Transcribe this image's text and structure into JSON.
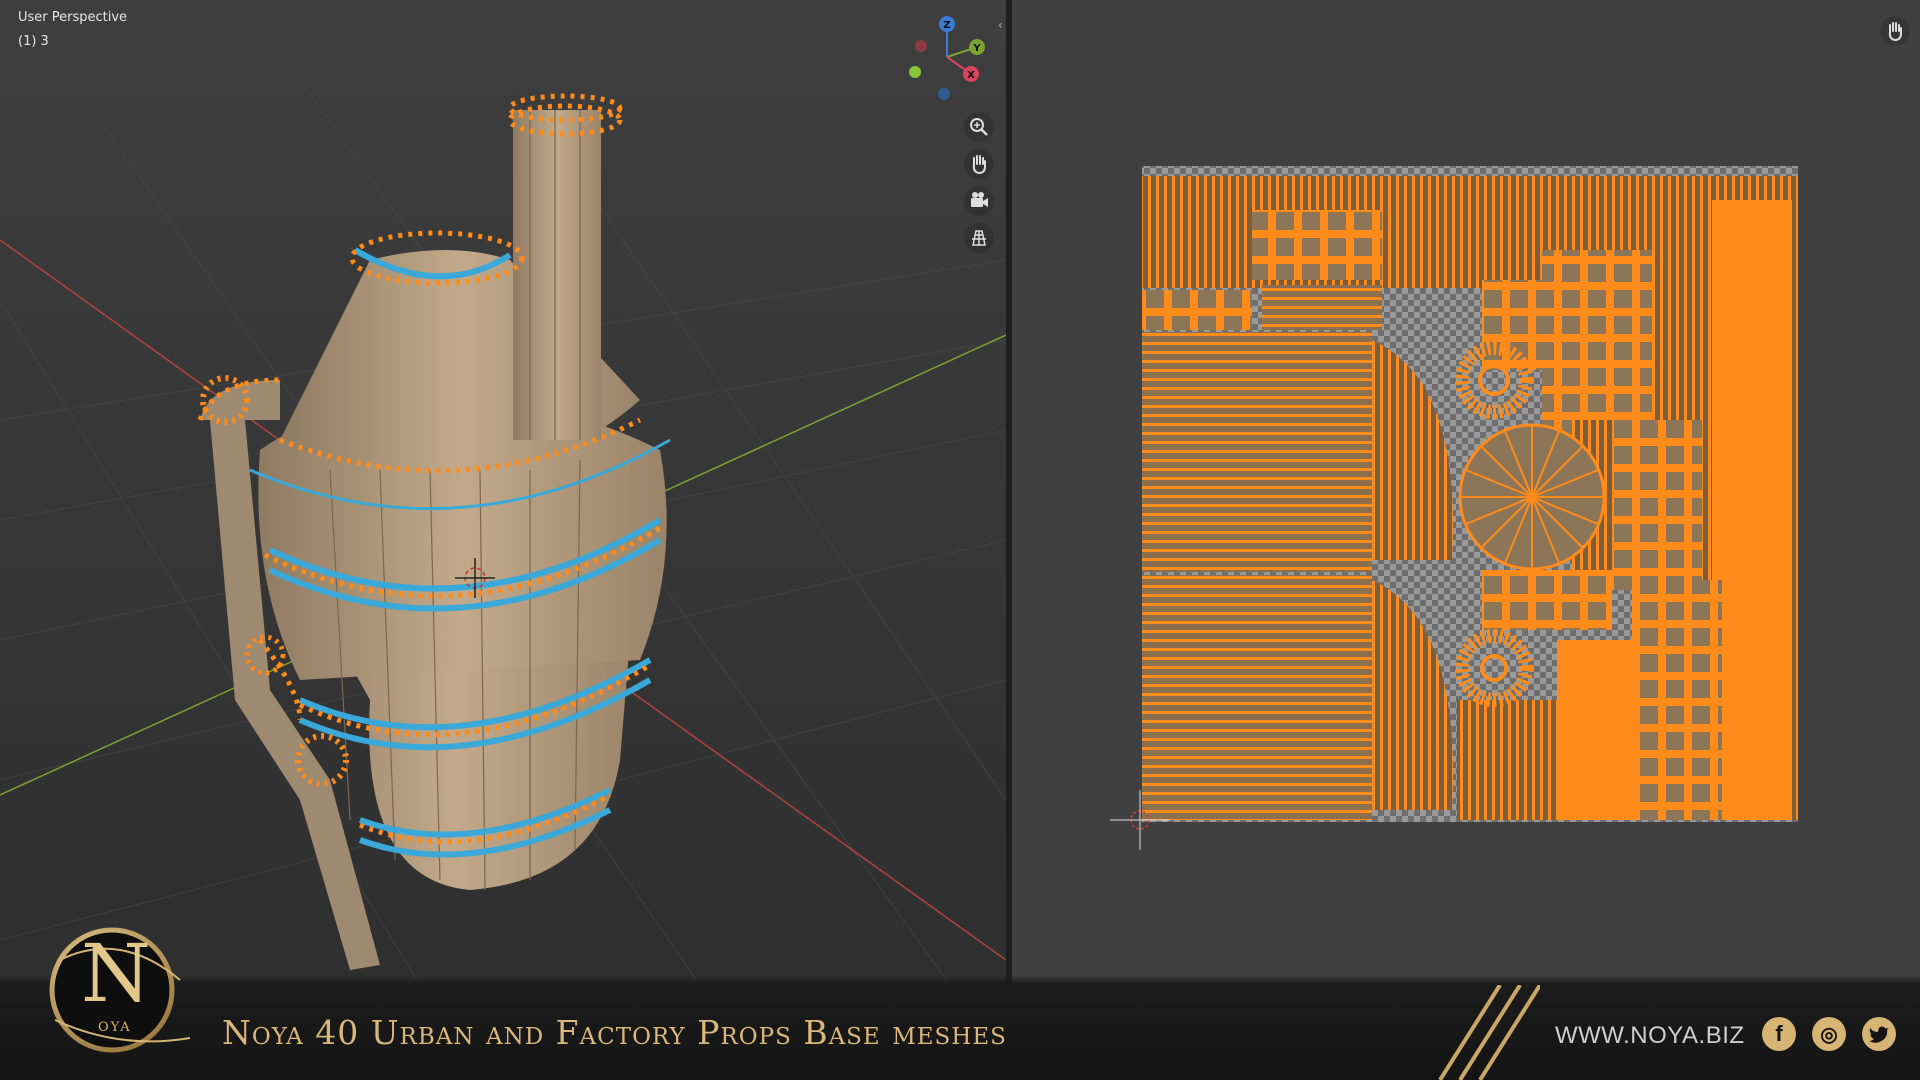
{
  "viewport": {
    "view_name": "User Perspective",
    "object_info": "(1) 3",
    "gizmo": {
      "z": "Z",
      "y": "Y",
      "x": "X"
    },
    "nav_icons": [
      "zoom-icon",
      "hand-pan-icon",
      "camera-icon",
      "grid-perspective-icon"
    ]
  },
  "uv_editor": {
    "nav_icons": [
      "hand-pan-icon"
    ]
  },
  "banner": {
    "logo_letter": "N",
    "logo_text": "OYA",
    "title": "Noya 40 Urban and Factory Props Base meshes",
    "url": "WWW.NOYA.BIZ",
    "social": [
      {
        "name": "facebook",
        "glyph": "f"
      },
      {
        "name": "instagram",
        "glyph": "◎"
      },
      {
        "name": "twitter",
        "glyph": "🐦"
      }
    ]
  },
  "colors": {
    "accent_orange": "#ff8c1a",
    "edge_blue": "#3aa8d8",
    "mesh_tan": "#b49a7c",
    "gold": "#d6b574",
    "axis_red": "#c0443c",
    "axis_green": "#7ca234"
  }
}
